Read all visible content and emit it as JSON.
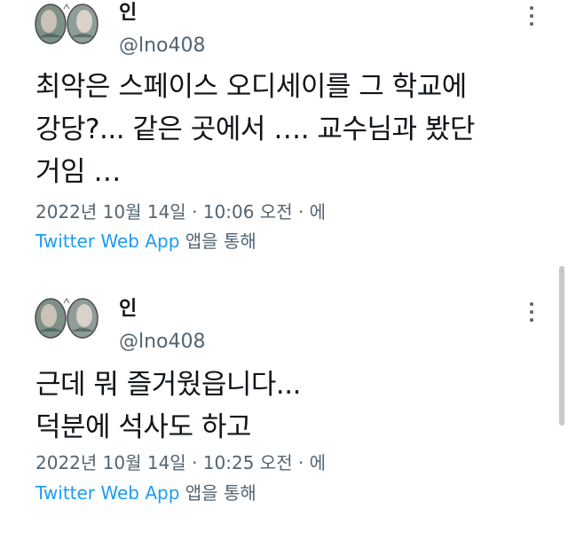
{
  "tweets": [
    {
      "display_name": "인",
      "handle": "@lno408",
      "text": "최악은 스페이스 오디세이를 그 학교에\n강당?... 같은 곳에서 …. 교수님과 봤단\n거임 …",
      "date": "2022년 10월 14일",
      "separator": "·",
      "time": "10:06 오전",
      "trailing": "· 에",
      "source_app": "Twitter Web App",
      "source_suffix": "앱을 통해",
      "more_icon": "more-vertical-icon"
    },
    {
      "display_name": "인",
      "handle": "@lno408",
      "text": "근데 뭐 즐거웠읍니다...\n덕분에 석사도 하고",
      "date": "2022년 10월 14일",
      "separator": "·",
      "time": "10:25 오전",
      "trailing": "· 에",
      "source_app": "Twitter Web App",
      "source_suffix": "앱을 통해",
      "more_icon": "more-vertical-icon"
    }
  ],
  "colors": {
    "text_primary": "#0f1419",
    "text_secondary": "#536471",
    "link": "#1d9bf0"
  }
}
